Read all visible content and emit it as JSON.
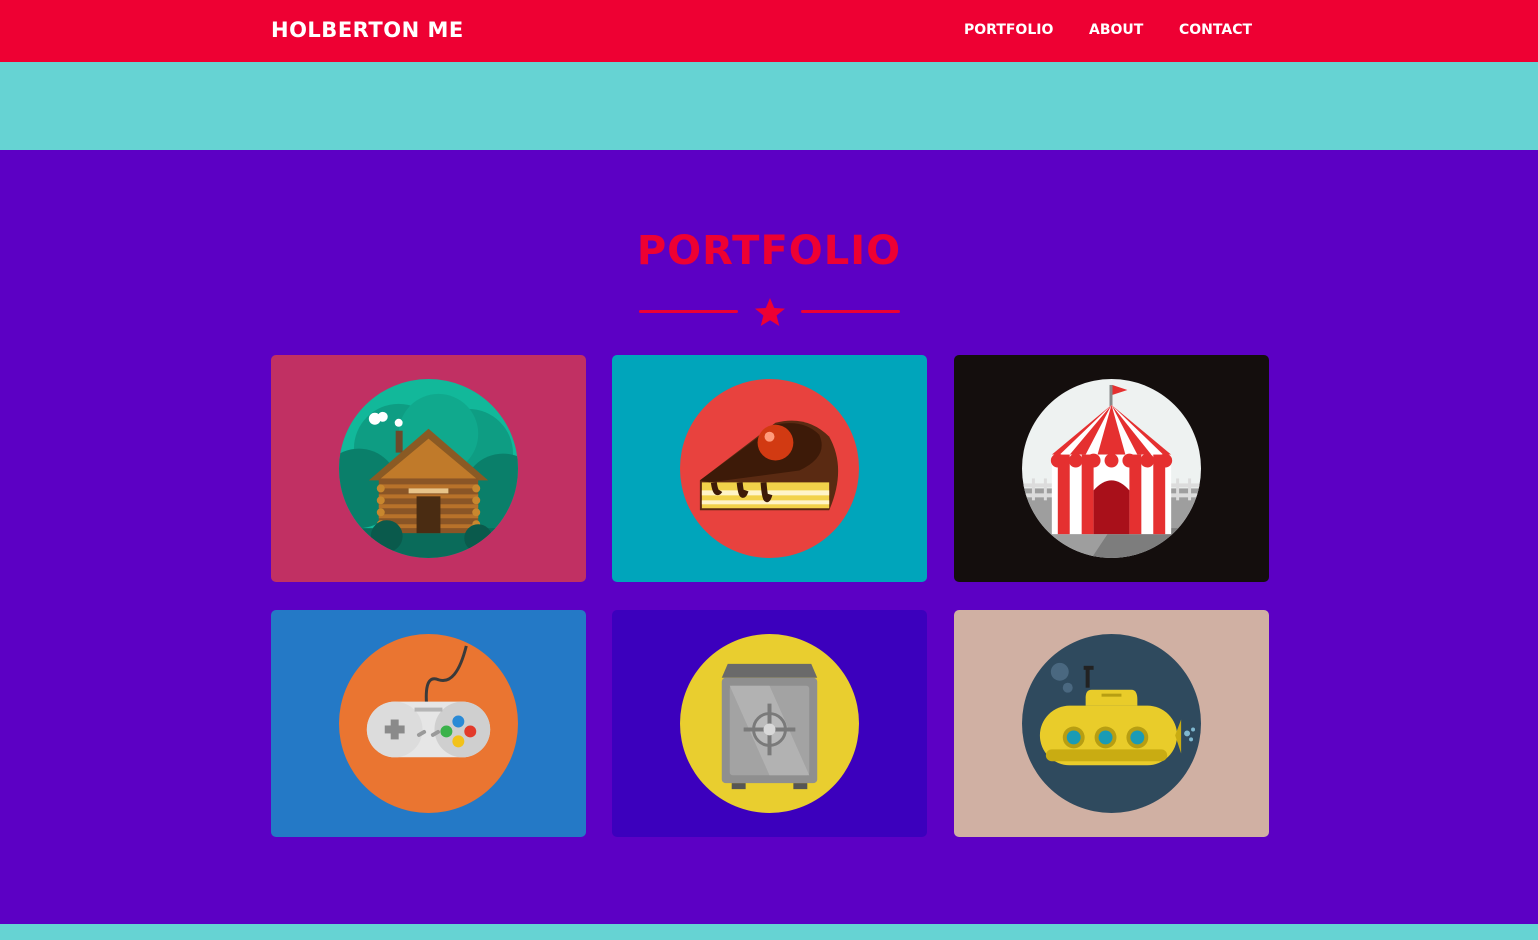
{
  "nav": {
    "brand": "HOLBERTON ME",
    "links": [
      "PORTFOLIO",
      "ABOUT",
      "CONTACT"
    ]
  },
  "portfolio": {
    "title": "PORTFOLIO",
    "items": [
      {
        "icon": "cabin-icon",
        "bg": "#c13063"
      },
      {
        "icon": "cake-icon",
        "bg": "#00a5bb"
      },
      {
        "icon": "circus-tent-icon",
        "bg": "#140e0d"
      },
      {
        "icon": "game-controller-icon",
        "bg": "#2479c6"
      },
      {
        "icon": "safe-icon",
        "bg": "#3c00bd"
      },
      {
        "icon": "submarine-icon",
        "bg": "#d0b0a3"
      }
    ]
  },
  "colors": {
    "nav_bg": "#ee0033",
    "band": "#66d3d3",
    "page_bg": "#5c00c4",
    "accent": "#ee0033"
  }
}
